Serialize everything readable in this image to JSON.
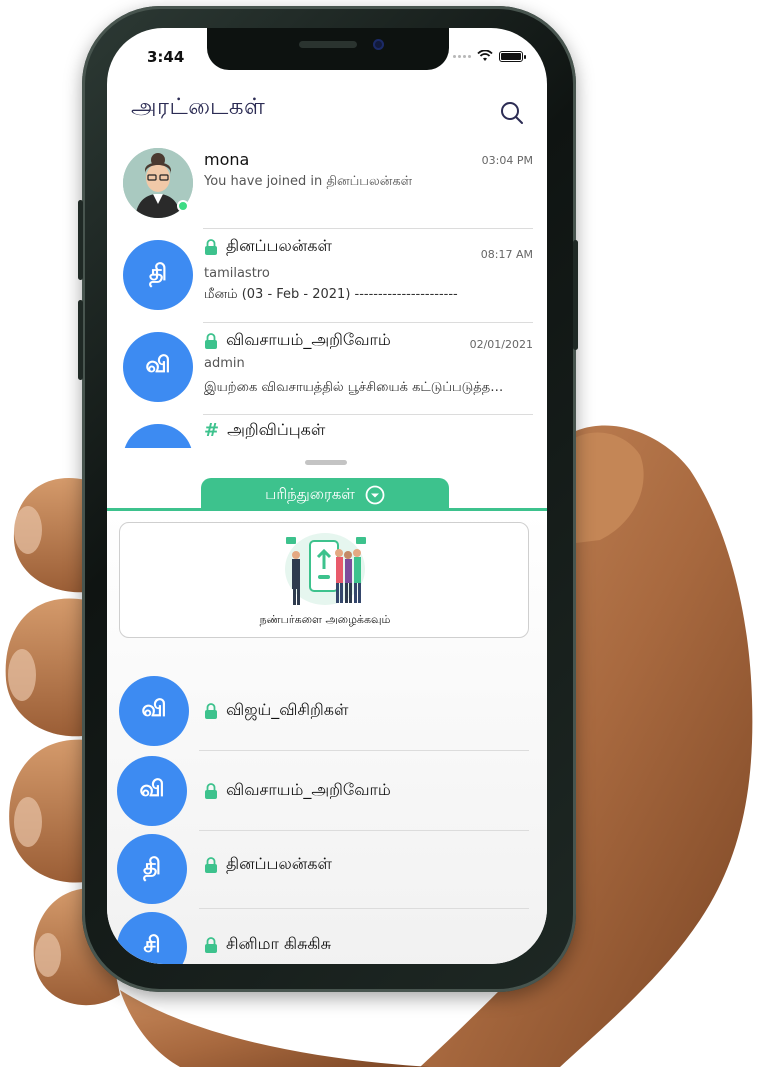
{
  "status_bar": {
    "time": "3:44"
  },
  "header": {
    "title": "அரட்டைகள்"
  },
  "chats": [
    {
      "avatar_letter": "",
      "title": "mona",
      "time": "03:04 PM",
      "line1": "You have joined in தினப்பலன்கள்",
      "line2": "",
      "locked": false
    },
    {
      "avatar_letter": "தி",
      "title": "தினப்பலன்கள்",
      "time": "08:17 AM",
      "line1": "tamilastro",
      "line2": "மீனம் (03 - Feb - 2021) ----------------------",
      "locked": true
    },
    {
      "avatar_letter": "வி",
      "title": "விவசாயம்_அறிவோம்",
      "time": "02/01/2021",
      "line1": "admin",
      "line2": "இயற்கை விவசாயத்தில் பூச்சியைக் கட்டுப்படுத்த…",
      "locked": true
    },
    {
      "avatar_letter": "",
      "title": "அறிவிப்புகள்",
      "time": "",
      "line1": "",
      "line2": "",
      "locked": false
    }
  ],
  "recommend_tab": {
    "label": "பரிந்துரைகள்"
  },
  "invite_card": {
    "label": "நண்பர்களை அழைக்கவும்"
  },
  "suggestions": [
    {
      "avatar_letter": "வி",
      "title": "விஜய்_விசிறிகள்"
    },
    {
      "avatar_letter": "வி",
      "title": "விவசாயம்_அறிவோம்"
    },
    {
      "avatar_letter": "தி",
      "title": "தினப்பலன்கள்"
    },
    {
      "avatar_letter": "சி",
      "title": "சினிமா கிசுகிசு"
    }
  ],
  "colors": {
    "accent": "#3dc28d",
    "avatar_blue": "#3d8bf2",
    "title_navy": "#2c2c54"
  },
  "icons": [
    "search-icon",
    "lock-icon",
    "hash-icon",
    "chevron-down-icon",
    "wifi-icon",
    "battery-icon",
    "signal-dots-icon"
  ]
}
